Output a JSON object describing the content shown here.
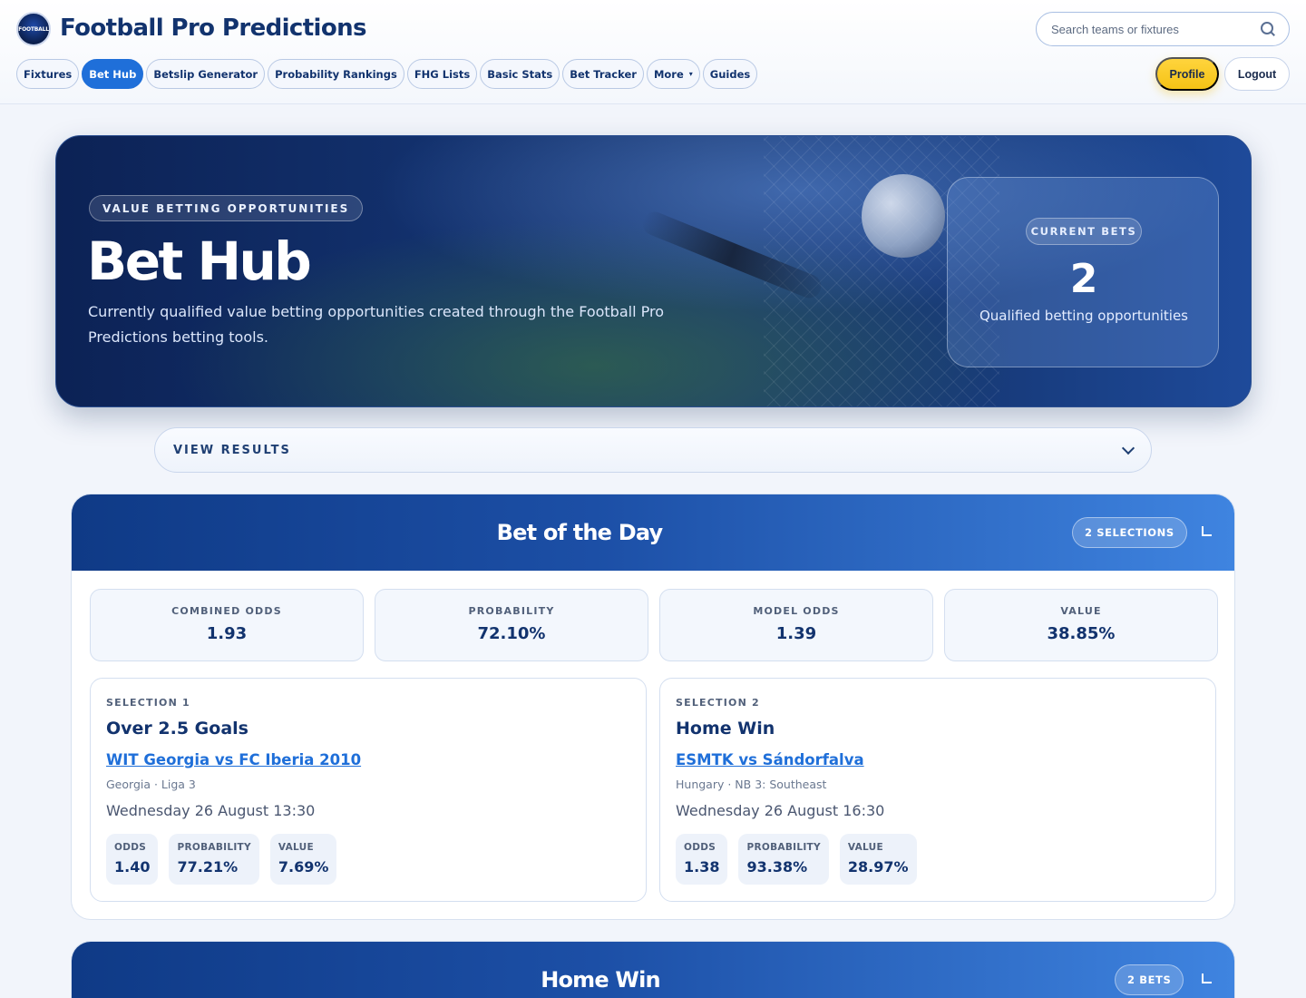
{
  "header": {
    "logo_text": "FOOTBALL",
    "brand": "Football Pro Predictions",
    "search_placeholder": "Search teams or fixtures",
    "nav": [
      {
        "label": "Fixtures"
      },
      {
        "label": "Bet Hub",
        "active": true
      },
      {
        "label": "Betslip Generator"
      },
      {
        "label": "Probability Rankings"
      },
      {
        "label": "FHG Lists"
      },
      {
        "label": "Basic Stats"
      },
      {
        "label": "Bet Tracker"
      },
      {
        "label": "More",
        "caret": "▾"
      },
      {
        "label": "Guides"
      }
    ],
    "profile_label": "Profile",
    "logout_label": "Logout"
  },
  "hero": {
    "tag": "VALUE BETTING OPPORTUNITIES",
    "title": "Bet Hub",
    "subtitle": "Currently qualified value betting opportunities created through the Football Pro Predictions betting tools.",
    "card": {
      "tag": "CURRENT BETS",
      "count": "2",
      "label": "Qualified betting opportunities"
    }
  },
  "results": {
    "label": "VIEW RESULTS"
  },
  "bet_of_the_day": {
    "title": "Bet of the Day",
    "badge": "2 SELECTIONS",
    "stats": [
      {
        "label": "COMBINED ODDS",
        "value": "1.93"
      },
      {
        "label": "PROBABILITY",
        "value": "72.10%"
      },
      {
        "label": "MODEL ODDS",
        "value": "1.39"
      },
      {
        "label": "VALUE",
        "value": "38.85%"
      }
    ],
    "selections": [
      {
        "tag": "SELECTION 1",
        "market": "Over 2.5 Goals",
        "fixture": "WIT Georgia vs FC Iberia 2010",
        "league": "Georgia · Liga 3",
        "date": "Wednesday 26 August 13:30",
        "metrics": [
          {
            "label": "ODDS",
            "value": "1.40"
          },
          {
            "label": "PROBABILITY",
            "value": "77.21%"
          },
          {
            "label": "VALUE",
            "value": "7.69%"
          }
        ]
      },
      {
        "tag": "SELECTION 2",
        "market": "Home Win",
        "fixture": "ESMTK vs Sándorfalva",
        "league": "Hungary · NB 3: Southeast",
        "date": "Wednesday 26 August 16:30",
        "metrics": [
          {
            "label": "ODDS",
            "value": "1.38"
          },
          {
            "label": "PROBABILITY",
            "value": "93.38%"
          },
          {
            "label": "VALUE",
            "value": "28.97%"
          }
        ]
      }
    ]
  },
  "home_win": {
    "title": "Home Win",
    "badge": "2 BETS"
  },
  "colors": {
    "accent": "#1f6fd9",
    "brand_navy": "#12336e",
    "profile_yellow": "#ffd43d"
  }
}
